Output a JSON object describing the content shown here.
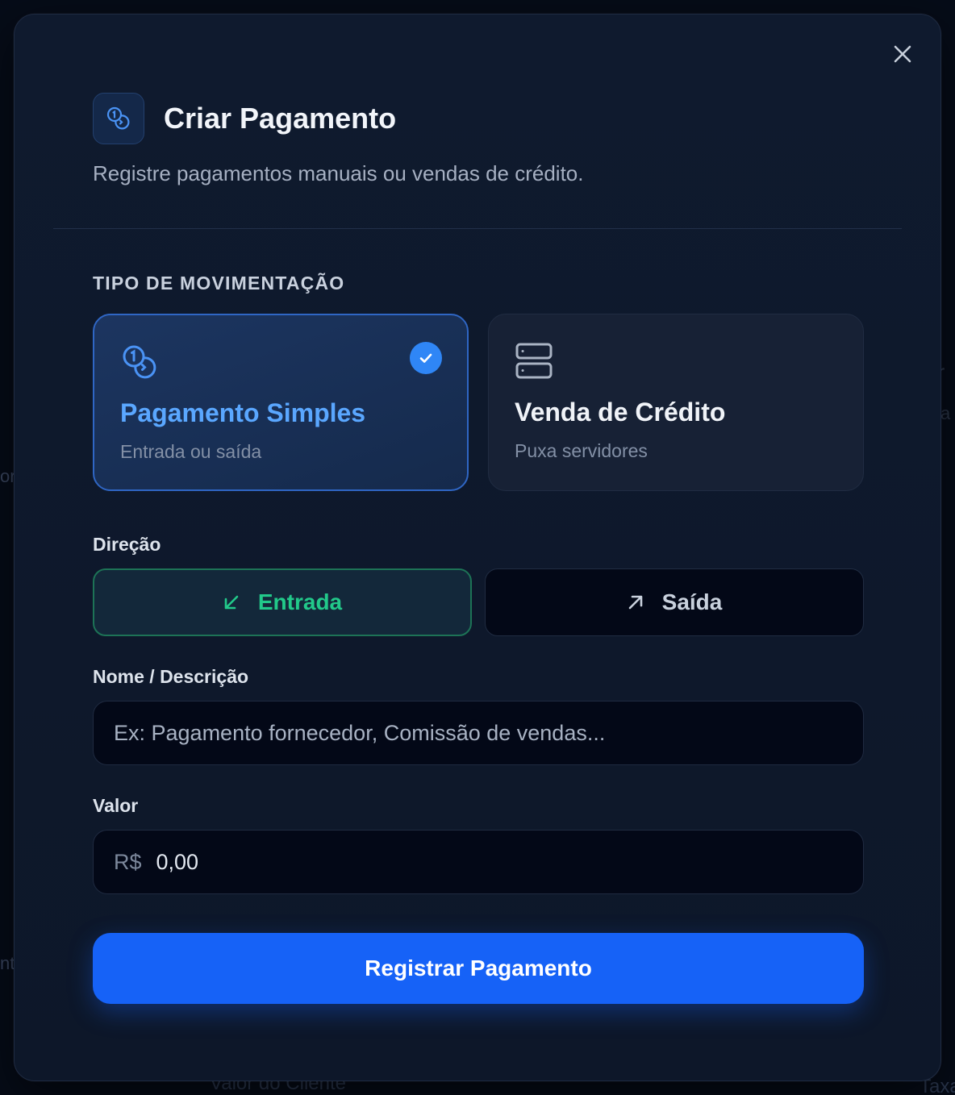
{
  "background_fragments": {
    "bottom": "Valor do Cliente",
    "left1": "or",
    "left2": "nt",
    "right1": "r",
    "right2": "a",
    "right3": "Taxa"
  },
  "modal": {
    "title": "Criar Pagamento",
    "subtitle": "Registre pagamentos manuais ou vendas de crédito.",
    "header_icon": "coins-icon",
    "close_icon": "close-icon"
  },
  "movement_type": {
    "label": "TIPO DE MOVIMENTAÇÃO",
    "options": [
      {
        "title": "Pagamento Simples",
        "subtitle": "Entrada ou saída",
        "icon": "coins-icon",
        "selected": true
      },
      {
        "title": "Venda de Crédito",
        "subtitle": "Puxa servidores",
        "icon": "server-icon",
        "selected": false
      }
    ]
  },
  "direction": {
    "label": "Direção",
    "options": [
      {
        "label": "Entrada",
        "icon": "arrow-down-left-icon",
        "selected": true
      },
      {
        "label": "Saída",
        "icon": "arrow-up-right-icon",
        "selected": false
      }
    ]
  },
  "name_field": {
    "label": "Nome / Descrição",
    "placeholder": "Ex: Pagamento fornecedor, Comissão de vendas...",
    "value": ""
  },
  "value_field": {
    "label": "Valor",
    "currency": "R$",
    "placeholder": "0,00",
    "value": ""
  },
  "submit": {
    "label": "Registrar Pagamento"
  },
  "colors": {
    "accent": "#1662f7",
    "selected_card_text": "#5aa7ff",
    "entrada_green": "#22c98a",
    "check_blue": "#2f86f6"
  }
}
